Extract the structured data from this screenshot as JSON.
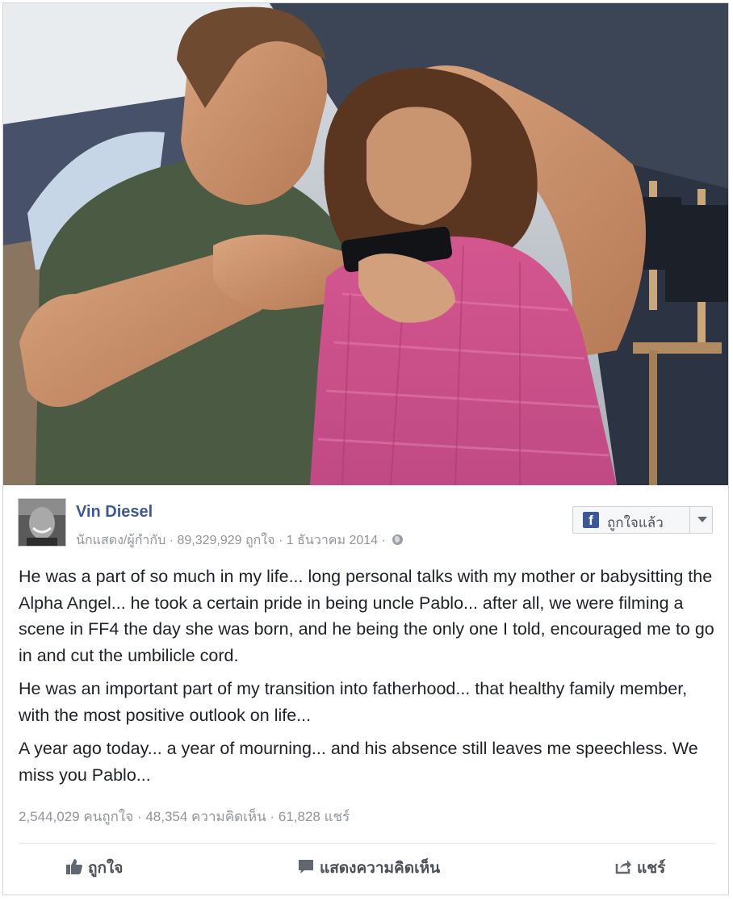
{
  "post": {
    "page_name": "Vin Diesel",
    "category": "นักแสดง/ผู้กำกับ",
    "likes_count": "89,329,929 ถูกใจ",
    "date": "1 ธันวาคม 2014",
    "privacy_icon": "globe-icon",
    "like_page_button": "ถูกใจแล้ว",
    "paragraphs": [
      "He was a part of so much in my life... long personal talks with my mother or babysitting the Alpha Angel... he took a certain pride in being uncle Pablo... after all, we were filming a scene in FF4 the day she was born, and he being the only one I told, encouraged me to go in and cut the umbilicle cord.",
      "He was an important part of my transition into fatherhood... that healthy family member, with the most positive outlook on life...",
      "A year ago today... a year of mourning... and his absence still leaves me speechless. We miss you Pablo..."
    ],
    "stats": {
      "likes": "2,544,029 คนถูกใจ",
      "comments": "48,354 ความคิดเห็น",
      "shares": "61,828 แชร์",
      "separator": " · "
    },
    "actions": {
      "like": "ถูกใจ",
      "comment": "แสดงความคิดเห็น",
      "share": "แชร์"
    }
  },
  "colors": {
    "brand": "#3b5998",
    "meta_text": "#90949c",
    "body_text": "#1d2129"
  }
}
